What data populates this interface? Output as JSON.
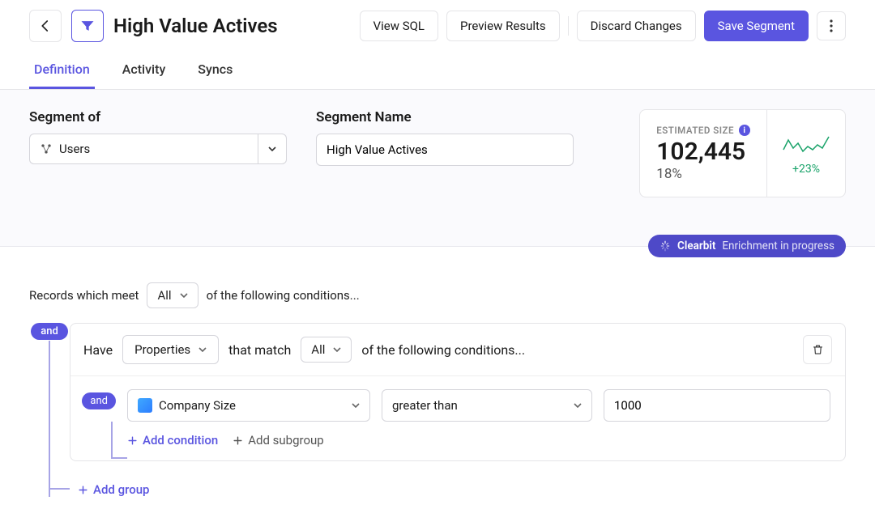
{
  "header": {
    "title": "High Value Actives",
    "view_sql": "View SQL",
    "preview": "Preview Results",
    "discard": "Discard Changes",
    "save": "Save Segment"
  },
  "tabs": {
    "definition": "Definition",
    "activity": "Activity",
    "syncs": "Syncs"
  },
  "form": {
    "segment_of_label": "Segment of",
    "segment_of_value": "Users",
    "segment_name_label": "Segment Name",
    "segment_name_value": "High Value Actives"
  },
  "estimate": {
    "label": "ESTIMATED SIZE",
    "value": "102,445",
    "percent": "18%",
    "delta": "+23%"
  },
  "enrichment": {
    "provider": "Clearbit",
    "status": "Enrichment in progress"
  },
  "conditions": {
    "intro_pre": "Records which meet",
    "all": "All",
    "intro_post": "of the following conditions...",
    "outer_and": "and",
    "group": {
      "have": "Have",
      "type": "Properties",
      "that_match": "that match",
      "inner_all": "All",
      "group_post": "of the following conditions...",
      "row": {
        "and": "and",
        "property": "Company Size",
        "operator": "greater than",
        "value": "1000"
      },
      "add_condition": "Add condition",
      "add_subgroup": "Add subgroup"
    },
    "add_group": "Add group"
  }
}
